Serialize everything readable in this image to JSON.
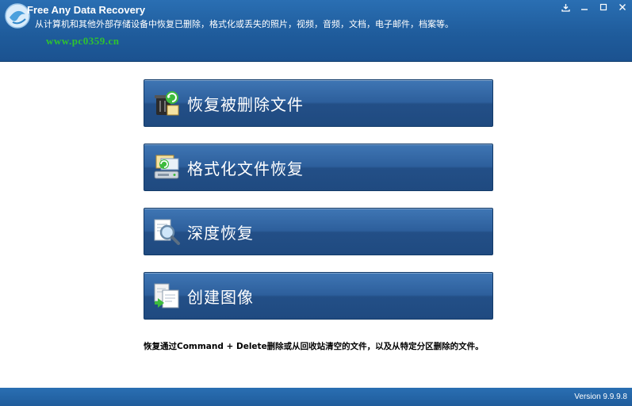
{
  "header": {
    "title": "Free Any Data Recovery",
    "subtitle": "从计算机和其他外部存储设备中恢复已删除，格式化或丢失的照片，视频，音频，文档，电子邮件，档案等。",
    "watermark_url": "www.pc0359.cn",
    "colors": {
      "header_bg": "#1f5c9c",
      "watermark": "#2fc42f"
    }
  },
  "window_controls": [
    "download-icon",
    "minimize-icon",
    "maximize-icon",
    "close-icon"
  ],
  "menu": {
    "items": [
      {
        "label": "恢复被删除文件",
        "icon": "trash-restore-icon"
      },
      {
        "label": "格式化文件恢复",
        "icon": "drive-restore-icon"
      },
      {
        "label": "深度恢复",
        "icon": "magnifier-icon"
      },
      {
        "label": "创建图像",
        "icon": "image-copy-icon"
      }
    ],
    "button_color": "#2d5f9c"
  },
  "footnote": "恢复通过Command + Delete删除或从回收站清空的文件，以及从特定分区删除的文件。",
  "footer": {
    "version": "Version 9.9.9.8"
  }
}
